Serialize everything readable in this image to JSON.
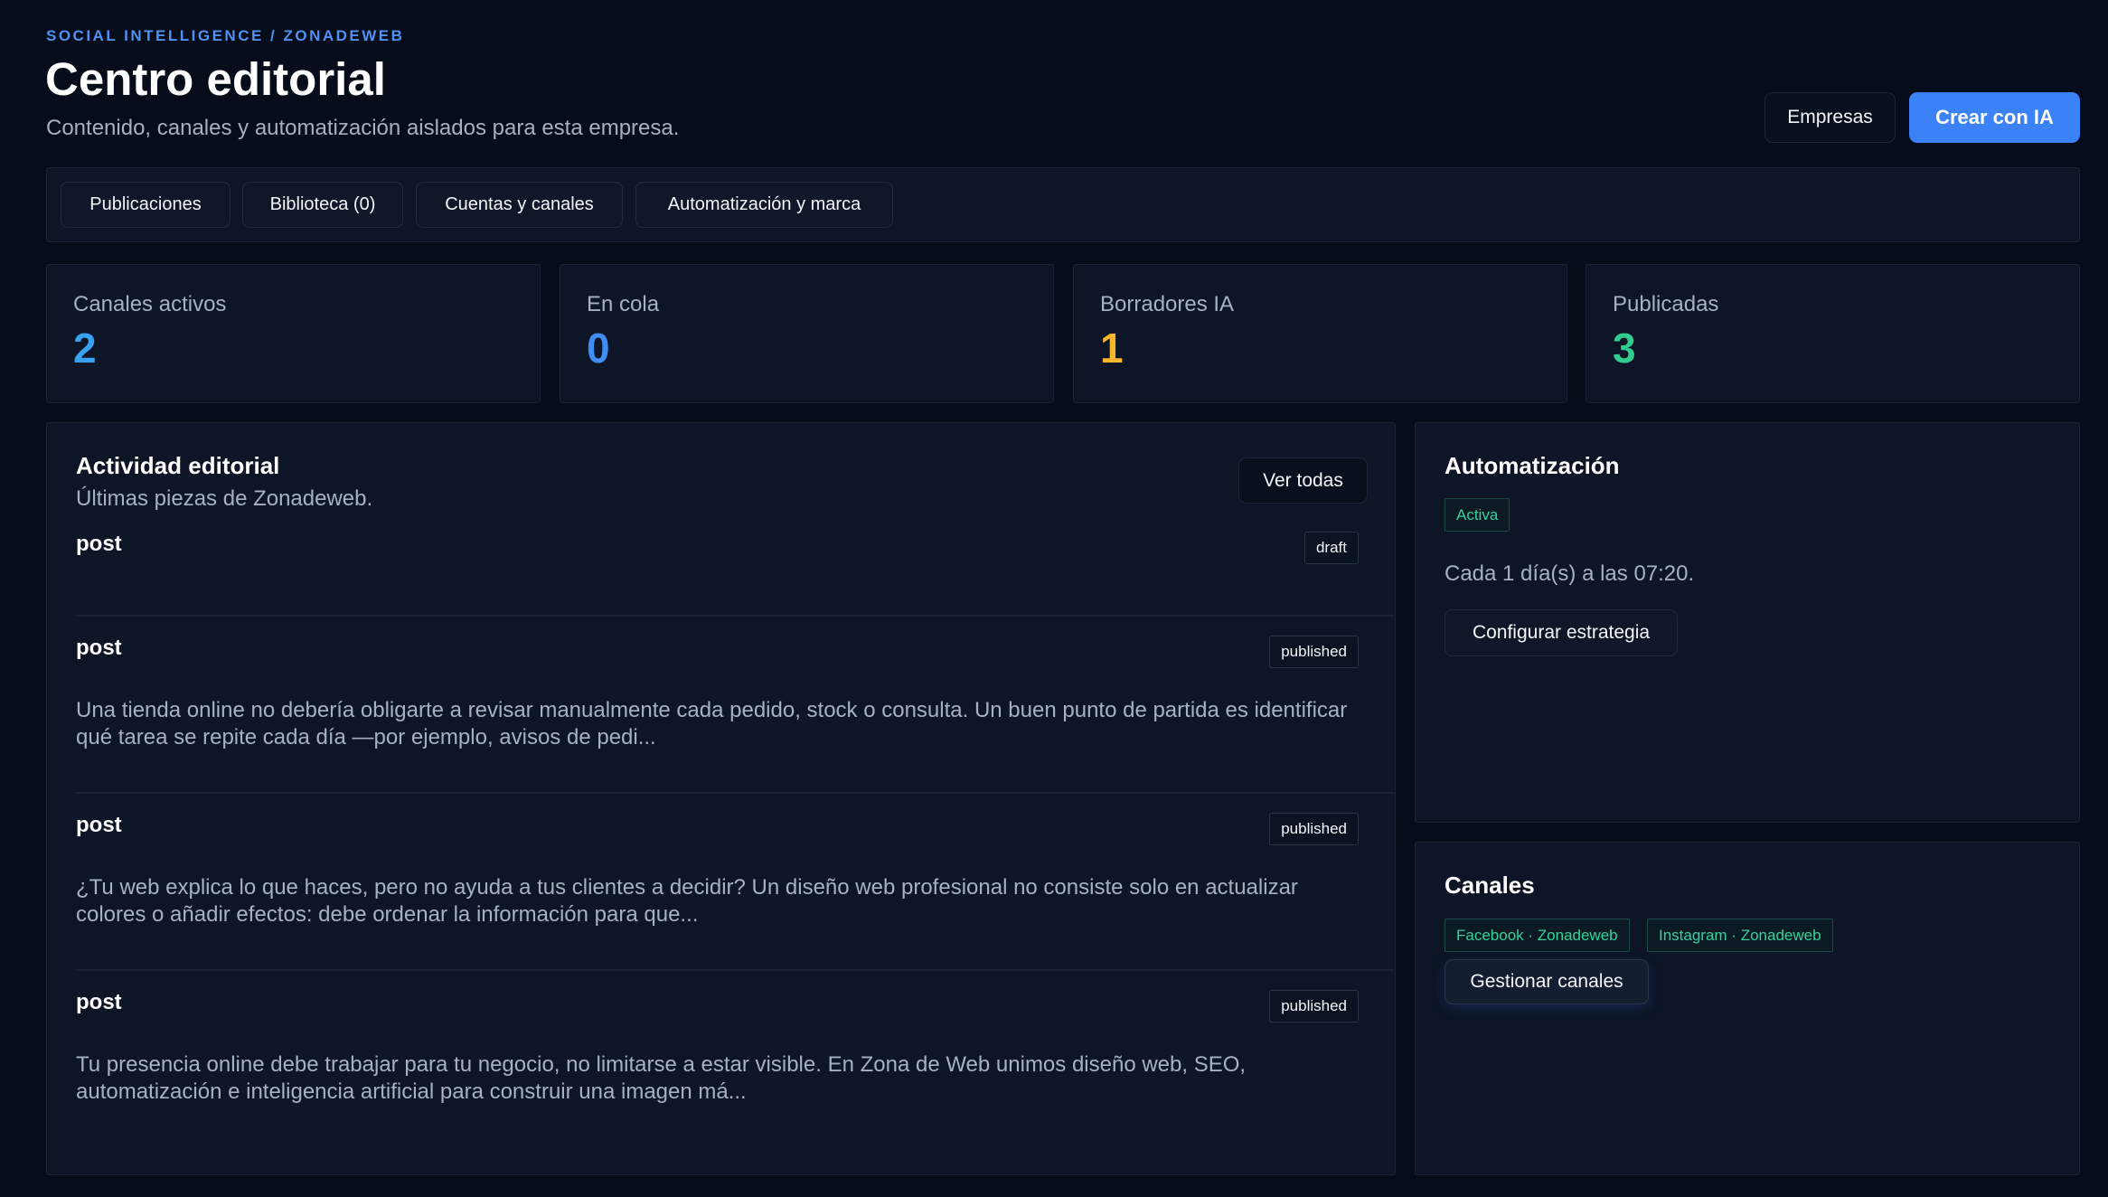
{
  "header": {
    "eyebrow": "SOCIAL INTELLIGENCE / ZONADEWEB",
    "title": "Centro editorial",
    "subtitle": "Contenido, canales y automatización aislados para esta empresa.",
    "empresas_label": "Empresas",
    "crear_label": "Crear con IA"
  },
  "tabs": [
    {
      "label": "Publicaciones"
    },
    {
      "label": "Biblioteca (0)"
    },
    {
      "label": "Cuentas y canales"
    },
    {
      "label": "Automatización y marca"
    }
  ],
  "stats": [
    {
      "label": "Canales activos",
      "value": "2",
      "color": "#3aa0f0"
    },
    {
      "label": "En cola",
      "value": "0",
      "color": "#3f8cf2"
    },
    {
      "label": "Borradores IA",
      "value": "1",
      "color": "#f5b52c"
    },
    {
      "label": "Publicadas",
      "value": "3",
      "color": "#33cc8f"
    }
  ],
  "activity": {
    "title": "Actividad editorial",
    "subtitle": "Últimas piezas de Zonadeweb.",
    "view_all_label": "Ver todas",
    "posts": [
      {
        "title": "post",
        "status": "draft",
        "excerpt": ""
      },
      {
        "title": "post",
        "status": "published",
        "excerpt": "Una tienda online no debería obligarte a revisar manualmente cada pedido, stock o consulta. Un buen punto de partida es identificar qué tarea se repite cada día —por ejemplo, avisos de pedi..."
      },
      {
        "title": "post",
        "status": "published",
        "excerpt": "¿Tu web explica lo que haces, pero no ayuda a tus clientes a decidir? Un diseño web profesional no consiste solo en actualizar colores o añadir efectos: debe ordenar la información para que..."
      },
      {
        "title": "post",
        "status": "published",
        "excerpt": "Tu presencia online debe trabajar para tu negocio, no limitarse a estar visible. En Zona de Web unimos diseño web, SEO, automatización e inteligencia artificial para construir una imagen má..."
      }
    ]
  },
  "automation": {
    "title": "Automatización",
    "status": "Activa",
    "schedule": "Cada 1 día(s) a las 07:20.",
    "configure_label": "Configurar estrategia"
  },
  "channels": {
    "title": "Canales",
    "items": [
      {
        "label": "Facebook · Zonadeweb"
      },
      {
        "label": "Instagram · Zonadeweb"
      }
    ],
    "manage_label": "Gestionar canales"
  },
  "colors": {
    "background": "#060c19",
    "card": "#0d1526",
    "primary": "#3b82f6",
    "success": "#34d399"
  }
}
